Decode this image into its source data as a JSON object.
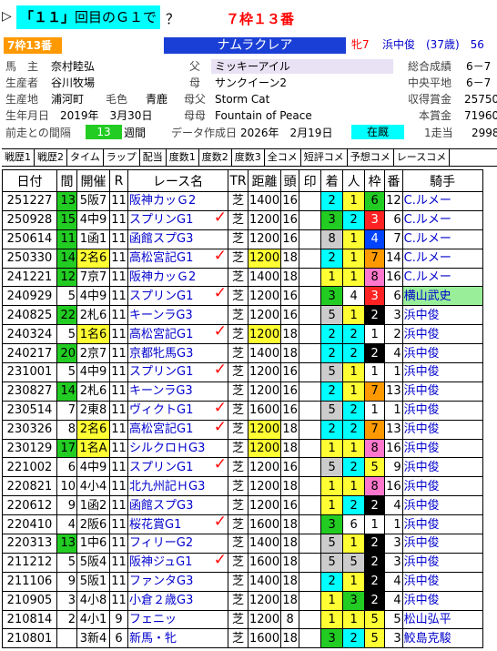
{
  "quiz": {
    "prefix": "▷",
    "question_bold": "「１１」",
    "question_rest": "回目のＧ１で",
    "question_suffix": "？",
    "answer": "７枠１３番"
  },
  "horse": {
    "gate_badge": "7枠13番",
    "name": "ナムラクレア",
    "sex_age": "牝7",
    "jockey_summary": "浜中俊　(37歳)　56",
    "owner_label": "馬　主",
    "owner": "奈村睦弘",
    "sire_label": "父",
    "sire": "ミッキーアイル",
    "record_label": "総合成績",
    "record": "6－7",
    "breeder_label": "生産者",
    "breeder": "谷川牧場",
    "dam_label": "母",
    "dam": "サンクイーン2",
    "central_label": "中央平地",
    "central": "6－7",
    "origin_label": "生産地",
    "origin": "浦河町",
    "coat_label": "毛色",
    "coat": "青鹿",
    "damsire_label": "母父",
    "damsire": "Storm Cat",
    "earnings_label": "収得賞金",
    "earnings": "25750",
    "birth_label": "生年月日",
    "birth": "2019年　3月30日",
    "damdam_label": "母母",
    "damdam": "Fountain of Peace",
    "prize_label": "本賞金",
    "prize": "71960",
    "interval_label": "前走との間隔",
    "interval": "13",
    "interval_unit": "週間",
    "created_label": "データ作成日",
    "created": "2026年　2月19日",
    "stable_status": "在厩",
    "first_label": "1走当",
    "first": "2998"
  },
  "menu": [
    "戦歴1",
    "戦歴2",
    "タイム",
    "ラップ",
    "配当",
    "度数1",
    "度数2",
    "度数3",
    "全コメ",
    "短評コメ",
    "予想コメ",
    "レースコメ"
  ],
  "columns": [
    "日付",
    "間",
    "開催",
    "R",
    "レース名",
    "TR",
    "距離",
    "頭",
    "印",
    "着",
    "人",
    "枠",
    "番",
    "騎手"
  ],
  "rows": [
    {
      "date": "251227",
      "int": "13",
      "int_hl": "green",
      "held": "5阪7",
      "held_hl": "",
      "r": "11",
      "race": "阪神カッＧ2",
      "check": false,
      "tr": "芝",
      "dist": "1400",
      "dist_hl": "",
      "heads": "16",
      "mark": "",
      "fin": "2",
      "pop": "1",
      "gate": "6",
      "num": "12",
      "jockey": "C.ルメー",
      "jhl": false
    },
    {
      "date": "250928",
      "int": "15",
      "int_hl": "green",
      "held": "4中9",
      "held_hl": "",
      "r": "11",
      "race": "スプリンG1",
      "check": true,
      "tr": "芝",
      "dist": "1200",
      "dist_hl": "",
      "heads": "16",
      "mark": "",
      "fin": "3",
      "pop": "2",
      "gate": "3",
      "num": "6",
      "jockey": "C.ルメー",
      "jhl": false
    },
    {
      "date": "250614",
      "int": "11",
      "int_hl": "green",
      "held": "1函1",
      "held_hl": "",
      "r": "11",
      "race": "函館スプG3",
      "check": false,
      "tr": "芝",
      "dist": "1200",
      "dist_hl": "",
      "heads": "16",
      "mark": "",
      "fin": "8",
      "pop": "1",
      "gate": "4",
      "num": "7",
      "jockey": "C.ルメー",
      "jhl": false
    },
    {
      "date": "250330",
      "int": "14",
      "int_hl": "green",
      "held": "2名6",
      "held_hl": "yellow",
      "r": "11",
      "race": "高松宮記G1",
      "check": true,
      "tr": "芝",
      "dist": "1200",
      "dist_hl": "yellow",
      "heads": "18",
      "mark": "",
      "fin": "2",
      "pop": "1",
      "gate": "7",
      "num": "14",
      "jockey": "C.ルメー",
      "jhl": false
    },
    {
      "date": "241221",
      "int": "12",
      "int_hl": "green",
      "held": "7京7",
      "held_hl": "",
      "r": "11",
      "race": "阪神カッＧ2",
      "check": false,
      "tr": "芝",
      "dist": "1400",
      "dist_hl": "",
      "heads": "18",
      "mark": "",
      "fin": "1",
      "pop": "1",
      "gate": "8",
      "num": "16",
      "jockey": "C.ルメー",
      "jhl": false
    },
    {
      "date": "240929",
      "int": "5",
      "int_hl": "",
      "held": "4中9",
      "held_hl": "",
      "r": "11",
      "race": "スプリンG1",
      "check": true,
      "tr": "芝",
      "dist": "1200",
      "dist_hl": "",
      "heads": "16",
      "mark": "",
      "fin": "3",
      "pop": "4",
      "gate": "3",
      "num": "6",
      "jockey": "横山武史",
      "jhl": true
    },
    {
      "date": "240825",
      "int": "22",
      "int_hl": "green",
      "held": "2札6",
      "held_hl": "",
      "r": "11",
      "race": "キーンラG3",
      "check": false,
      "tr": "芝",
      "dist": "1200",
      "dist_hl": "",
      "heads": "16",
      "mark": "",
      "fin": "5",
      "pop": "1",
      "gate": "2",
      "num": "3",
      "jockey": "浜中俊",
      "jhl": false
    },
    {
      "date": "240324",
      "int": "5",
      "int_hl": "",
      "held": "1名6",
      "held_hl": "yellow",
      "r": "11",
      "race": "高松宮記G1",
      "check": true,
      "tr": "芝",
      "dist": "1200",
      "dist_hl": "yellow",
      "heads": "18",
      "mark": "",
      "fin": "2",
      "pop": "2",
      "gate": "1",
      "num": "2",
      "jockey": "浜中俊",
      "jhl": false
    },
    {
      "date": "240217",
      "int": "20",
      "int_hl": "green",
      "held": "2京7",
      "held_hl": "",
      "r": "11",
      "race": "京都牝馬G3",
      "check": false,
      "tr": "芝",
      "dist": "1400",
      "dist_hl": "",
      "heads": "18",
      "mark": "",
      "fin": "2",
      "pop": "2",
      "gate": "2",
      "num": "4",
      "jockey": "浜中俊",
      "jhl": false
    },
    {
      "date": "231001",
      "int": "5",
      "int_hl": "",
      "held": "4中9",
      "held_hl": "",
      "r": "11",
      "race": "スプリンG1",
      "check": true,
      "tr": "芝",
      "dist": "1200",
      "dist_hl": "",
      "heads": "16",
      "mark": "",
      "fin": "5",
      "pop": "1",
      "gate": "1",
      "num": "1",
      "jockey": "浜中俊",
      "jhl": false
    },
    {
      "date": "230827",
      "int": "14",
      "int_hl": "green",
      "held": "2札6",
      "held_hl": "",
      "r": "11",
      "race": "キーンラG3",
      "check": false,
      "tr": "芝",
      "dist": "1200",
      "dist_hl": "",
      "heads": "16",
      "mark": "",
      "fin": "2",
      "pop": "1",
      "gate": "7",
      "num": "13",
      "jockey": "浜中俊",
      "jhl": false
    },
    {
      "date": "230514",
      "int": "7",
      "int_hl": "",
      "held": "2東8",
      "held_hl": "",
      "r": "11",
      "race": "ヴィクトG1",
      "check": true,
      "tr": "芝",
      "dist": "1600",
      "dist_hl": "",
      "heads": "16",
      "mark": "",
      "fin": "5",
      "pop": "2",
      "gate": "1",
      "num": "1",
      "jockey": "浜中俊",
      "jhl": false
    },
    {
      "date": "230326",
      "int": "8",
      "int_hl": "",
      "held": "2名6",
      "held_hl": "yellow",
      "r": "11",
      "race": "高松宮記G1",
      "check": true,
      "tr": "芝",
      "dist": "1200",
      "dist_hl": "yellow",
      "heads": "18",
      "mark": "",
      "fin": "2",
      "pop": "2",
      "gate": "7",
      "num": "13",
      "jockey": "浜中俊",
      "jhl": false
    },
    {
      "date": "230129",
      "int": "17",
      "int_hl": "green",
      "held": "1名A",
      "held_hl": "yellow",
      "r": "11",
      "race": "シルクロＨG3",
      "check": false,
      "tr": "芝",
      "dist": "1200",
      "dist_hl": "yellow",
      "heads": "18",
      "mark": "",
      "fin": "1",
      "pop": "1",
      "gate": "8",
      "num": "16",
      "jockey": "浜中俊",
      "jhl": false
    },
    {
      "date": "221002",
      "int": "6",
      "int_hl": "",
      "held": "4中9",
      "held_hl": "",
      "r": "11",
      "race": "スプリンG1",
      "check": true,
      "tr": "芝",
      "dist": "1200",
      "dist_hl": "",
      "heads": "16",
      "mark": "",
      "fin": "5",
      "pop": "2",
      "gate": "5",
      "num": "9",
      "jockey": "浜中俊",
      "jhl": false
    },
    {
      "date": "220821",
      "int": "10",
      "int_hl": "",
      "held": "4小4",
      "held_hl": "",
      "r": "11",
      "race": "北九州記ＨG3",
      "check": false,
      "tr": "芝",
      "dist": "1200",
      "dist_hl": "",
      "heads": "18",
      "mark": "",
      "fin": "1",
      "pop": "1",
      "gate": "8",
      "num": "16",
      "jockey": "浜中俊",
      "jhl": false
    },
    {
      "date": "220612",
      "int": "9",
      "int_hl": "",
      "held": "1函2",
      "held_hl": "",
      "r": "11",
      "race": "函館スプG3",
      "check": false,
      "tr": "芝",
      "dist": "1200",
      "dist_hl": "",
      "heads": "16",
      "mark": "",
      "fin": "1",
      "pop": "2",
      "gate": "2",
      "num": "4",
      "jockey": "浜中俊",
      "jhl": false
    },
    {
      "date": "220410",
      "int": "4",
      "int_hl": "",
      "held": "2阪6",
      "held_hl": "",
      "r": "11",
      "race": "桜花賞G1",
      "check": true,
      "tr": "芝",
      "dist": "1600",
      "dist_hl": "",
      "heads": "18",
      "mark": "",
      "fin": "3",
      "pop": "6",
      "gate": "1",
      "num": "1",
      "jockey": "浜中俊",
      "jhl": false
    },
    {
      "date": "220313",
      "int": "13",
      "int_hl": "green",
      "held": "1中6",
      "held_hl": "",
      "r": "11",
      "race": "フィリーG2",
      "check": false,
      "tr": "芝",
      "dist": "1400",
      "dist_hl": "",
      "heads": "18",
      "mark": "",
      "fin": "5",
      "pop": "1",
      "gate": "2",
      "num": "3",
      "jockey": "浜中俊",
      "jhl": false
    },
    {
      "date": "211212",
      "int": "5",
      "int_hl": "",
      "held": "5阪4",
      "held_hl": "",
      "r": "11",
      "race": "阪神ジュG1",
      "check": true,
      "tr": "芝",
      "dist": "1600",
      "dist_hl": "",
      "heads": "18",
      "mark": "",
      "fin": "5",
      "pop": "5",
      "gate": "2",
      "num": "3",
      "jockey": "浜中俊",
      "jhl": false
    },
    {
      "date": "211106",
      "int": "9",
      "int_hl": "",
      "held": "5阪1",
      "held_hl": "",
      "r": "11",
      "race": "ファンタG3",
      "check": false,
      "tr": "芝",
      "dist": "1400",
      "dist_hl": "",
      "heads": "18",
      "mark": "",
      "fin": "2",
      "pop": "1",
      "gate": "2",
      "num": "4",
      "jockey": "浜中俊",
      "jhl": false
    },
    {
      "date": "210905",
      "int": "3",
      "int_hl": "",
      "held": "4小8",
      "held_hl": "",
      "r": "11",
      "race": "小倉２歳G3",
      "check": false,
      "tr": "芝",
      "dist": "1200",
      "dist_hl": "",
      "heads": "18",
      "mark": "",
      "fin": "1",
      "pop": "3",
      "gate": "2",
      "num": "4",
      "jockey": "浜中俊",
      "jhl": false
    },
    {
      "date": "210814",
      "int": "2",
      "int_hl": "",
      "held": "4小1",
      "held_hl": "",
      "r": "9",
      "race": "フェニッ",
      "check": false,
      "tr": "芝",
      "dist": "1200",
      "dist_hl": "",
      "heads": "8",
      "mark": "",
      "fin": "1",
      "pop": "1",
      "gate": "5",
      "num": "5",
      "jockey": "松山弘平",
      "jhl": false
    },
    {
      "date": "210801",
      "int": "",
      "int_hl": "",
      "held": "3新4",
      "held_hl": "",
      "r": "6",
      "race": "新馬・牝",
      "check": false,
      "tr": "芝",
      "dist": "1600",
      "dist_hl": "",
      "heads": "18",
      "mark": "",
      "fin": "3",
      "pop": "2",
      "gate": "5",
      "num": "3",
      "jockey": "鮫島克駿",
      "jhl": false
    }
  ]
}
